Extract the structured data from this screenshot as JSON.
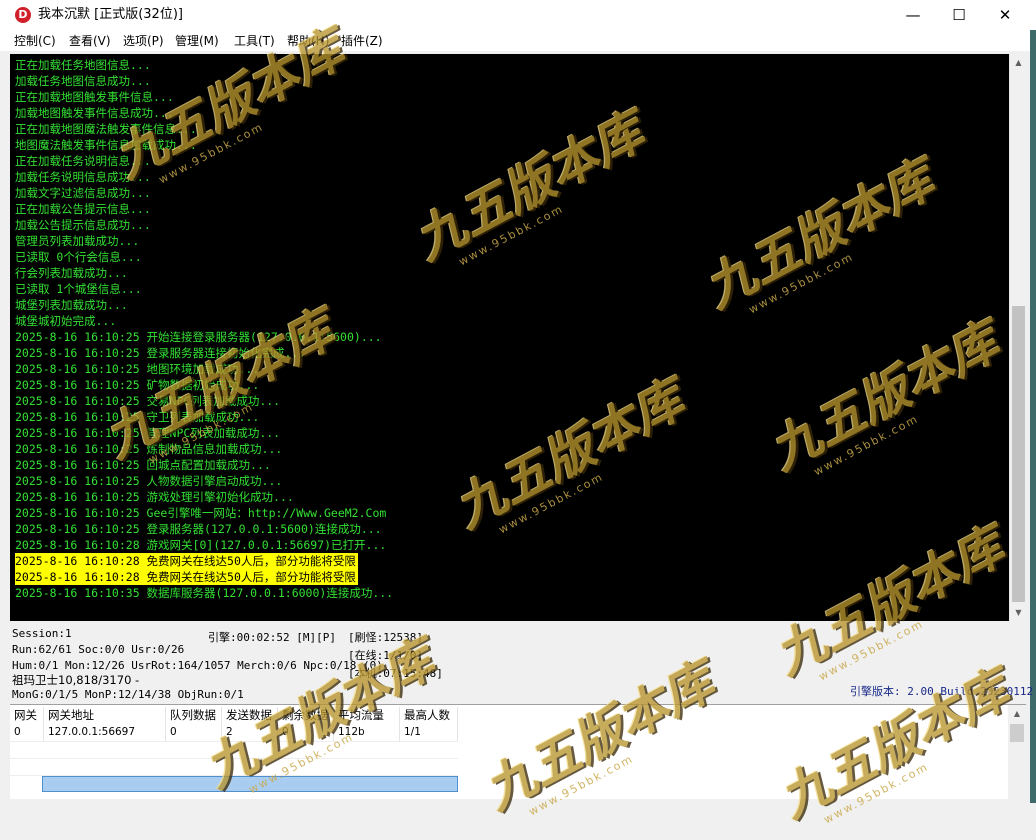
{
  "window": {
    "title": "我本沉默 [正式版(32位)]",
    "icon_letter": "D",
    "minimize_glyph": "—",
    "maximize_glyph": "☐",
    "close_glyph": "✕"
  },
  "menu": [
    {
      "label": "控制(C)"
    },
    {
      "label": "查看(V)"
    },
    {
      "label": "选项(P)"
    },
    {
      "label": "管理(M)"
    },
    {
      "label": "工具(T)"
    },
    {
      "label": "帮助(H)"
    },
    {
      "label": "插件(Z)"
    }
  ],
  "console": {
    "text_color": "#33e033",
    "highlight_bg": "#ffff00",
    "highlight_text": "#000000",
    "lines": [
      {
        "text": "正在加载任务地图信息...",
        "highlight": false
      },
      {
        "text": "加载任务地图信息成功...",
        "highlight": false
      },
      {
        "text": "正在加载地图触发事件信息...",
        "highlight": false
      },
      {
        "text": "加载地图触发事件信息成功...",
        "highlight": false
      },
      {
        "text": "正在加载地图魔法触发事件信息...",
        "highlight": false
      },
      {
        "text": "地图魔法触发事件信息加载成功...",
        "highlight": false
      },
      {
        "text": "正在加载任务说明信息...",
        "highlight": false
      },
      {
        "text": "加载任务说明信息成功...",
        "highlight": false
      },
      {
        "text": "加载文字过滤信息成功...",
        "highlight": false
      },
      {
        "text": "正在加载公告提示信息...",
        "highlight": false
      },
      {
        "text": "加载公告提示信息成功...",
        "highlight": false
      },
      {
        "text": "管理员列表加载成功...",
        "highlight": false
      },
      {
        "text": "已读取 0个行会信息...",
        "highlight": false
      },
      {
        "text": "行会列表加载成功...",
        "highlight": false
      },
      {
        "text": "已读取 1个城堡信息...",
        "highlight": false
      },
      {
        "text": "城堡列表加载成功...",
        "highlight": false
      },
      {
        "text": "城堡城初始完成...",
        "highlight": false
      },
      {
        "text": "2025-8-16 16:10:25 开始连接登录服务器(127.0.0.1:5600)...",
        "highlight": false
      },
      {
        "text": "2025-8-16 16:10:25 登录服务器连接初始化完成...",
        "highlight": false
      },
      {
        "text": "2025-8-16 16:10:25 地图环境加载成功...",
        "highlight": false
      },
      {
        "text": "2025-8-16 16:10:25 矿物数据初始成功...",
        "highlight": false
      },
      {
        "text": "2025-8-16 16:10:25 交易NPC列表加载成功...",
        "highlight": false
      },
      {
        "text": "2025-8-16 16:10:25 守卫列表加载成功...",
        "highlight": false
      },
      {
        "text": "2025-8-16 16:10:25 管理NPC列表加载成功...",
        "highlight": false
      },
      {
        "text": "2025-8-16 16:10:25 炼制物品信息加载成功...",
        "highlight": false
      },
      {
        "text": "2025-8-16 16:10:25 回城点配置加载成功...",
        "highlight": false
      },
      {
        "text": "2025-8-16 16:10:25 人物数据引擎启动成功...",
        "highlight": false
      },
      {
        "text": "2025-8-16 16:10:25 游戏处理引擎初始化成功...",
        "highlight": false
      },
      {
        "text": "2025-8-16 16:10:25 Gee引擎唯一网站：http://Www.GeeM2.Com",
        "highlight": false
      },
      {
        "text": "2025-8-16 16:10:25 登录服务器(127.0.0.1:5600)连接成功...",
        "highlight": false
      },
      {
        "text": "2025-8-16 16:10:28 游戏网关[0](127.0.0.1:56697)已打开...",
        "highlight": false
      },
      {
        "text": "2025-8-16 16:10:28 免费网关在线达50人后，部分功能将受限",
        "highlight": true
      },
      {
        "text": "2025-8-16 16:10:28 免费网关在线达50人后，部分功能将受限",
        "highlight": true
      },
      {
        "text": "2025-8-16 16:10:35 数据库服务器(127.0.0.1:6000)连接成功...",
        "highlight": false
      }
    ]
  },
  "status": {
    "session": "Session:1",
    "run": "Run:62/61 Soc:0/0 Usr:0/26",
    "hum": "Hum:0/1 Mon:12/26 UsrRot:164/1057 Merch:0/6 Npc:0/18 (0)",
    "monster_info": "祖玛卫士10,818/3170 -",
    "mong": "MonG:0/1/5 MonP:12/14/38 ObjRun:0/1",
    "engine_time": "引擎:00:02:52 [M][P]",
    "refresh_monsters": "[刷怪:12538]",
    "online": "[在线:1/1/0]",
    "local": "[本机:07:15:48]",
    "engine_version": "引擎版本: 2.00 Build 20230112"
  },
  "gateway_table": {
    "columns": [
      "网关",
      "网关地址",
      "队列数据",
      "发送数据",
      "剩余数据",
      "平均流量",
      "最高人数"
    ],
    "rows": [
      [
        "0",
        "127.0.0.1:56697",
        "0",
        "2",
        "0",
        "112b",
        "1/1"
      ]
    ]
  },
  "watermark": {
    "brand": "九五版本库",
    "url": "www.95bbk.com",
    "color": "#b8952e"
  }
}
